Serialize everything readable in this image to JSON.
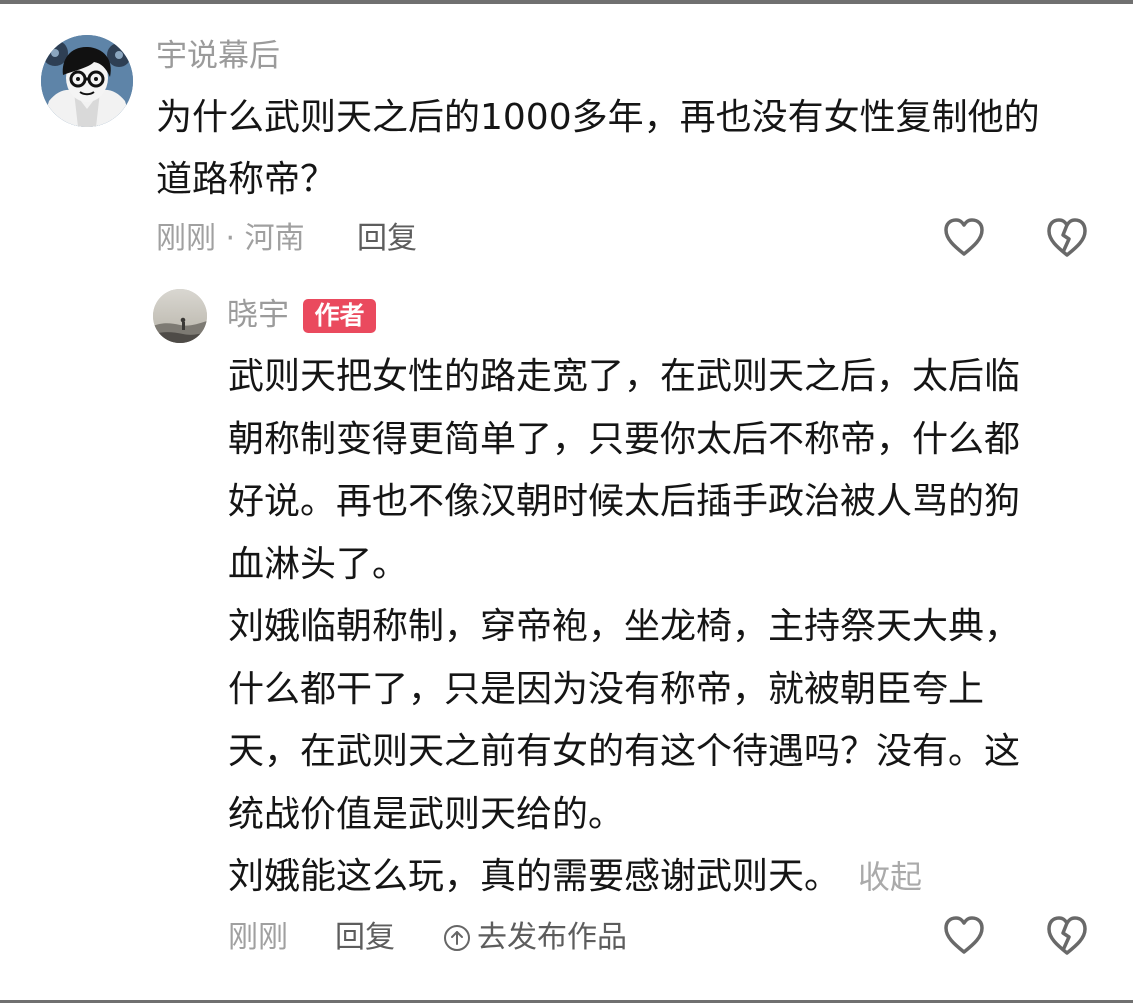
{
  "comment": {
    "author": "宇说幕后",
    "text_lines": [
      "为什么武则天之后的1000多年，再也没有女性复制他的",
      "道路称帝？"
    ],
    "meta": "刚刚 · 河南",
    "reply_label": "回复"
  },
  "reply": {
    "author": "晓宇",
    "badge": "作者",
    "lines": [
      "武则天把女性的路走宽了，在武则天之后，太后临",
      "朝称制变得更简单了，只要你太后不称帝，什么都",
      "好说。再也不像汉朝时候太后插手政治被人骂的狗",
      "血淋头了。",
      "刘娥临朝称制，穿帝袍，坐龙椅，主持祭天大典，",
      "什么都干了，只是因为没有称帝，就被朝臣夸上",
      "天，在武则天之前有女的有这个待遇吗？没有。这",
      "统战价值是武则天给的。",
      "刘娥能这么玩，真的需要感谢武则天。"
    ],
    "collapse_label": "收起",
    "meta": "刚刚",
    "reply_label": "回复",
    "publish_label": "去发布作品"
  },
  "icons": {
    "avatar_main": "cartoon-avatar-icon",
    "avatar_reply": "photo-avatar-icon",
    "like": "heart-icon",
    "dislike": "broken-heart-icon",
    "publish": "upload-icon"
  },
  "colors": {
    "badge": "#ea4a5e",
    "text": "#151515",
    "muted": "#9b9b9b"
  }
}
